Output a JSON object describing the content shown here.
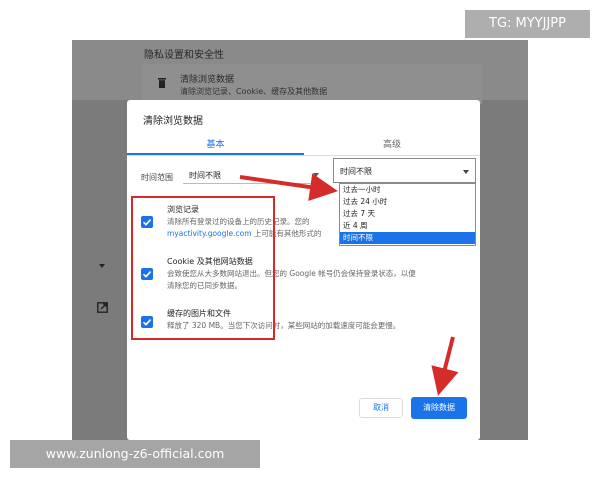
{
  "background_page": {
    "section_title": "隐私设置和安全性",
    "row_title": "清除浏览数据",
    "row_subtitle": "清除浏览记录、Cookie、缓存及其他数据"
  },
  "dialog": {
    "title": "清除浏览数据",
    "tabs": [
      {
        "label": "基本",
        "active": true
      },
      {
        "label": "高级",
        "active": false
      }
    ],
    "time_range": {
      "label": "时间范围",
      "value": "时间不限"
    },
    "items": [
      {
        "title": "浏览记录",
        "desc_line1": "清除所有登录过的设备上的历史记录。您的",
        "desc_link": "myactivity.google.com",
        "desc_line2_rest": "上可能有其他形式的",
        "checked": true
      },
      {
        "title": "Cookie 及其他网站数据",
        "desc_line1": "会致使您从大多数网站退出。但您的 Google 帐号仍会保持登录状态，以便",
        "desc_line2": "清除您的已同步数据。",
        "checked": true
      },
      {
        "title": "缓存的图片和文件",
        "desc_line1": "释放了 320 MB。当您下次访问时，某些网站的加载速度可能会更慢。",
        "checked": true
      }
    ],
    "buttons": {
      "cancel": "取消",
      "clear": "清除数据"
    }
  },
  "dropdown": {
    "selected": "时间不限",
    "options": [
      "过去一小时",
      "过去 24 小时",
      "过去 7 天",
      "近 4 周",
      "时间不限"
    ],
    "selected_index": 4
  },
  "watermarks": {
    "top_right": "TG: MYYJJPP",
    "bottom_left": "www.zunlong-z6-official.com"
  },
  "colors": {
    "accent": "#1a73e8",
    "annotation_red": "#d62b2b",
    "overlay": "#7b7b7b"
  }
}
